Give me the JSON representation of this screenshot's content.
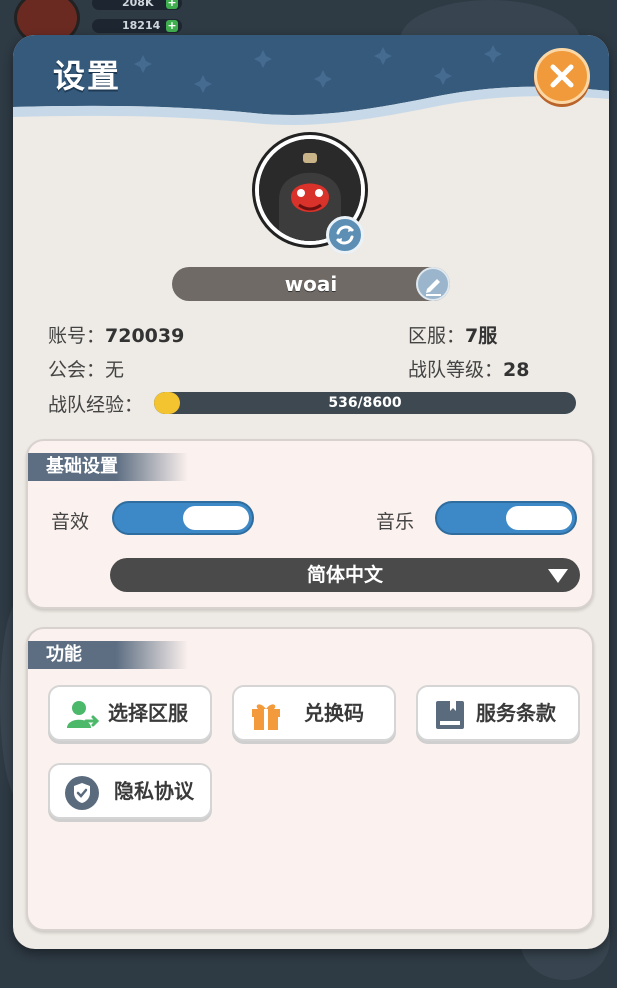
{
  "hud": {
    "gold": "208K",
    "gems": "18214"
  },
  "dialog": {
    "title": "设置"
  },
  "profile": {
    "name": "woai",
    "account_label": "账号：",
    "account_value": "720039",
    "server_label": "区服：",
    "server_value": "7服",
    "guild_label": "公会：",
    "guild_value": "无",
    "team_level_label": "战队等级：",
    "team_level_value": "28",
    "exp_label": "战队经验：",
    "exp_text": "536/8600",
    "exp_current": 536,
    "exp_max": 8600
  },
  "basic_settings": {
    "title": "基础设置",
    "sound_label": "音效",
    "sound_on": true,
    "music_label": "音乐",
    "music_on": true,
    "language": "简体中文"
  },
  "functions": {
    "title": "功能",
    "buttons": [
      {
        "label": "选择区服",
        "icon": "user-switch-icon"
      },
      {
        "label": "兑换码",
        "icon": "gift-icon"
      },
      {
        "label": "服务条款",
        "icon": "book-icon"
      },
      {
        "label": "隐私协议",
        "icon": "shield-icon"
      }
    ]
  },
  "colors": {
    "panel": "#eeeae5",
    "header": "#355a7c",
    "toggle_on": "#3d88c6",
    "close": "#f19a3b",
    "exp_fill": "#f4c430"
  }
}
